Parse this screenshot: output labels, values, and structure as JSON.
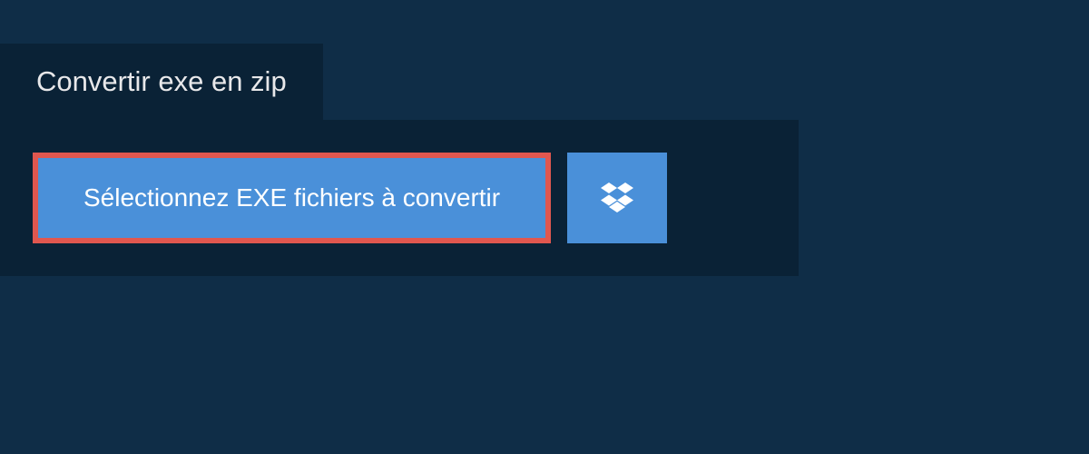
{
  "tab": {
    "title": "Convertir exe en zip"
  },
  "panel": {
    "select_label": "Sélectionnez EXE fichiers à convertir"
  }
}
